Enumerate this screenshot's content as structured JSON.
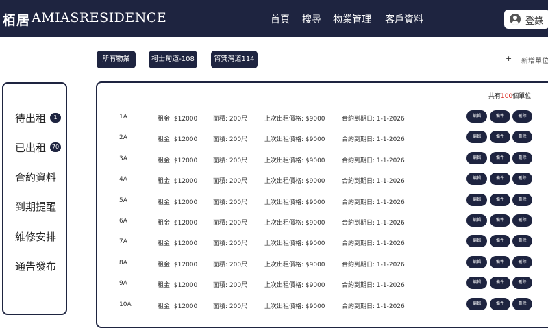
{
  "header": {
    "brand_cn": "栢居",
    "brand_en": "AMIASRESIDENCE",
    "nav": [
      "首頁",
      "搜尋",
      "物業管理",
      "客戶資料"
    ],
    "login_label": "登錄",
    "login_icon": "user-icon"
  },
  "filters": [
    "所有物業",
    "柯士甸道-108",
    "筲箕灣道114"
  ],
  "add_unit": {
    "icon": "+",
    "label": "新增單位"
  },
  "sidebar": [
    {
      "label": "待出租",
      "badge": "1"
    },
    {
      "label": "已出租",
      "badge": "70"
    },
    {
      "label": "合約資料"
    },
    {
      "label": "到期提醒"
    },
    {
      "label": "維修安排"
    },
    {
      "label": "通告發布"
    }
  ],
  "summary": {
    "prefix": "共有",
    "count": "100",
    "suffix": "個單位"
  },
  "row_buttons": [
    "編輯",
    "備件",
    "刪除"
  ],
  "units": [
    {
      "unit": "1A",
      "rent": "租金: $12000",
      "area": "面積: 200尺",
      "last_rent": "上次出租價格: $9000",
      "expiry": "合約到期日: 1-1-2026"
    },
    {
      "unit": "2A",
      "rent": "租金: $12000",
      "area": "面積: 200尺",
      "last_rent": "上次出租價格: $9000",
      "expiry": "合約到期日: 1-1-2026"
    },
    {
      "unit": "3A",
      "rent": "租金: $12000",
      "area": "面積: 200尺",
      "last_rent": "上次出租價格: $9000",
      "expiry": "合約到期日: 1-1-2026"
    },
    {
      "unit": "4A",
      "rent": "租金: $12000",
      "area": "面積: 200尺",
      "last_rent": "上次出租價格: $9000",
      "expiry": "合約到期日: 1-1-2026"
    },
    {
      "unit": "5A",
      "rent": "租金: $12000",
      "area": "面積: 200尺",
      "last_rent": "上次出租價格: $9000",
      "expiry": "合約到期日: 1-1-2026"
    },
    {
      "unit": "6A",
      "rent": "租金: $12000",
      "area": "面積: 200尺",
      "last_rent": "上次出租價格: $9000",
      "expiry": "合約到期日: 1-1-2026"
    },
    {
      "unit": "7A",
      "rent": "租金: $12000",
      "area": "面積: 200尺",
      "last_rent": "上次出租價格: $9000",
      "expiry": "合約到期日: 1-1-2026"
    },
    {
      "unit": "8A",
      "rent": "租金: $12000",
      "area": "面積: 200尺",
      "last_rent": "上次出租價格: $9000",
      "expiry": "合約到期日: 1-1-2026"
    },
    {
      "unit": "9A",
      "rent": "租金: $12000",
      "area": "面積: 200尺",
      "last_rent": "上次出租價格: $9000",
      "expiry": "合約到期日: 1-1-2026"
    },
    {
      "unit": "10A",
      "rent": "租金: $12000",
      "area": "面積: 200尺",
      "last_rent": "上次出租價格: $9000",
      "expiry": "合約到期日: 1-1-2026"
    }
  ],
  "colors": {
    "primary": "#1e2440",
    "accent": "#d9261c"
  }
}
